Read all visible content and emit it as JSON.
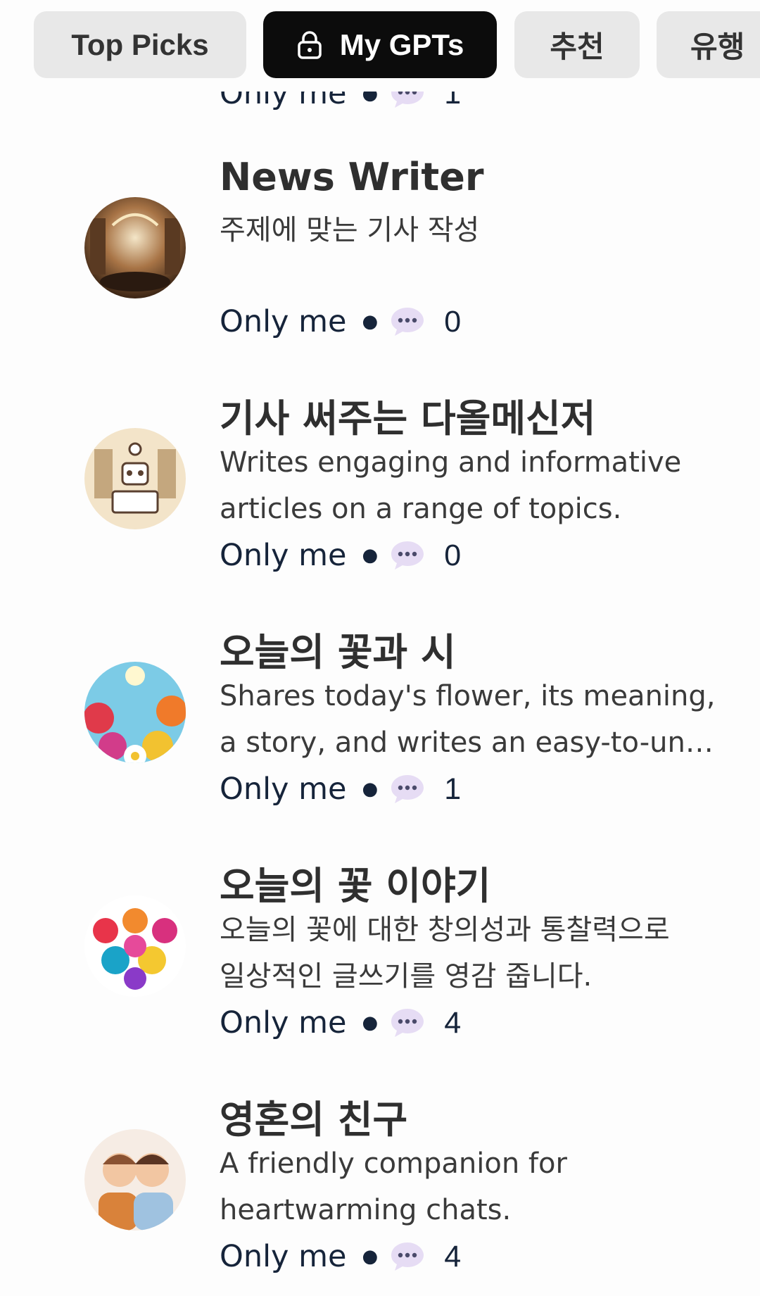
{
  "tabs": [
    {
      "label": "Top Picks",
      "active": false
    },
    {
      "label": "My GPTs",
      "active": true
    },
    {
      "label": "추천",
      "active": false
    },
    {
      "label": "유행",
      "active": false
    }
  ],
  "partial_item": {
    "visibility": "Only me",
    "count": "1"
  },
  "items": [
    {
      "title": "News Writer",
      "desc_lines": [
        "주제에 맞는 기사 작성",
        ""
      ],
      "visibility": "Only me",
      "count": "0",
      "avatar_icon": "library-avatar"
    },
    {
      "title": "기사 써주는 다올메신저",
      "desc_lines": [
        "Writes engaging and informative",
        "articles on a range of topics."
      ],
      "visibility": "Only me",
      "count": "0",
      "avatar_icon": "robot-typewriter-avatar"
    },
    {
      "title": "오늘의 꽃과 시",
      "desc_lines": [
        "Shares today's flower, its meaning,",
        "a story, and writes an easy-to-un…"
      ],
      "visibility": "Only me",
      "count": "1",
      "avatar_icon": "flower-sky-avatar"
    },
    {
      "title": "오늘의 꽃 이야기",
      "desc_lines": [
        "오늘의 꽃에 대한 창의성과 통찰력으로",
        "일상적인 글쓰기를 영감 줍니다."
      ],
      "visibility": "Only me",
      "count": "4",
      "avatar_icon": "flower-bouquet-avatar"
    },
    {
      "title": "영혼의 친구",
      "desc_lines": [
        "A friendly companion for",
        "heartwarming chats."
      ],
      "visibility": "Only me",
      "count": "4",
      "avatar_icon": "friends-avatar"
    }
  ],
  "colors": {
    "active_tab": "#0c0c0c",
    "inactive_tab": "#e8e8e8",
    "meta_text": "#16243a"
  }
}
